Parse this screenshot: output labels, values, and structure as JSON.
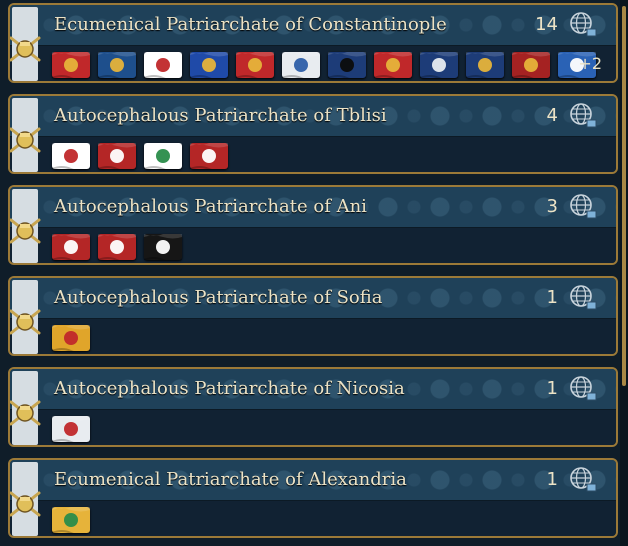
{
  "patriarchates": [
    {
      "name": "Ecumenical Patriarchate of Constantinople",
      "count": "14",
      "more": "+2",
      "flags": [
        {
          "icon": "four-betas-cross-flag",
          "bg": "#c0282a",
          "fg": "#e6b33a"
        },
        {
          "icon": "cross-anchor-flag",
          "bg": "#1e4f8c",
          "fg": "#e6b33a"
        },
        {
          "icon": "white-eagle-flag",
          "bg": "#ffffff",
          "fg": "#c0282a"
        },
        {
          "icon": "lion-flag",
          "bg": "#1f4aa8",
          "fg": "#e6b33a"
        },
        {
          "icon": "double-eagle-flag",
          "bg": "#c0282a",
          "fg": "#e6b33a"
        },
        {
          "icon": "white-blue-lion-flag",
          "bg": "#e8ecf0",
          "fg": "#2e5fa8"
        },
        {
          "icon": "dark-figure-flag",
          "bg": "#1d3c78",
          "fg": "#0c0c0c"
        },
        {
          "icon": "gold-emblem-flag",
          "bg": "#c0282a",
          "fg": "#e6b33a"
        },
        {
          "icon": "white-angel-flag",
          "bg": "#1d3c78",
          "fg": "#e8ecf0"
        },
        {
          "icon": "gold-lion-flag",
          "bg": "#1d3c78",
          "fg": "#e6b33a"
        },
        {
          "icon": "red-lion-flag",
          "bg": "#a52222",
          "fg": "#e6b33a"
        },
        {
          "icon": "white-cross-flag",
          "bg": "#2a62b5",
          "fg": "#ffffff"
        }
      ]
    },
    {
      "name": "Autocephalous Patriarchate of Tblisi",
      "count": "4",
      "flags": [
        {
          "icon": "georgian-cross-flag",
          "bg": "#ffffff",
          "fg": "#c0282a"
        },
        {
          "icon": "red-cross-flag",
          "bg": "#b42626",
          "fg": "#ffffff"
        },
        {
          "icon": "cross-stripes-flag",
          "bg": "#ffffff",
          "fg": "#2a8c4a"
        },
        {
          "icon": "white-horse-flag",
          "bg": "#b42626",
          "fg": "#ffffff"
        }
      ]
    },
    {
      "name": "Autocephalous Patriarchate of Ani",
      "count": "3",
      "flags": [
        {
          "icon": "lion-flag",
          "bg": "#b42626",
          "fg": "#ffffff"
        },
        {
          "icon": "crosses-flag",
          "bg": "#b42626",
          "fg": "#ffffff"
        },
        {
          "icon": "black-cross-flag",
          "bg": "#161616",
          "fg": "#ffffff"
        }
      ]
    },
    {
      "name": "Autocephalous Patriarchate of Sofia",
      "count": "1",
      "flags": [
        {
          "icon": "lions-stripes-flag",
          "bg": "#e0a52a",
          "fg": "#c0282a"
        }
      ]
    },
    {
      "name": "Autocephalous Patriarchate of Nicosia",
      "count": "1",
      "flags": [
        {
          "icon": "quartered-arms-flag",
          "bg": "#e8ecf0",
          "fg": "#c0282a"
        }
      ]
    },
    {
      "name": "Ecumenical Patriarchate of Alexandria",
      "count": "1",
      "flags": [
        {
          "icon": "green-gold-red-flag",
          "bg": "#e6b33a",
          "fg": "#2a8c4a"
        }
      ]
    }
  ]
}
